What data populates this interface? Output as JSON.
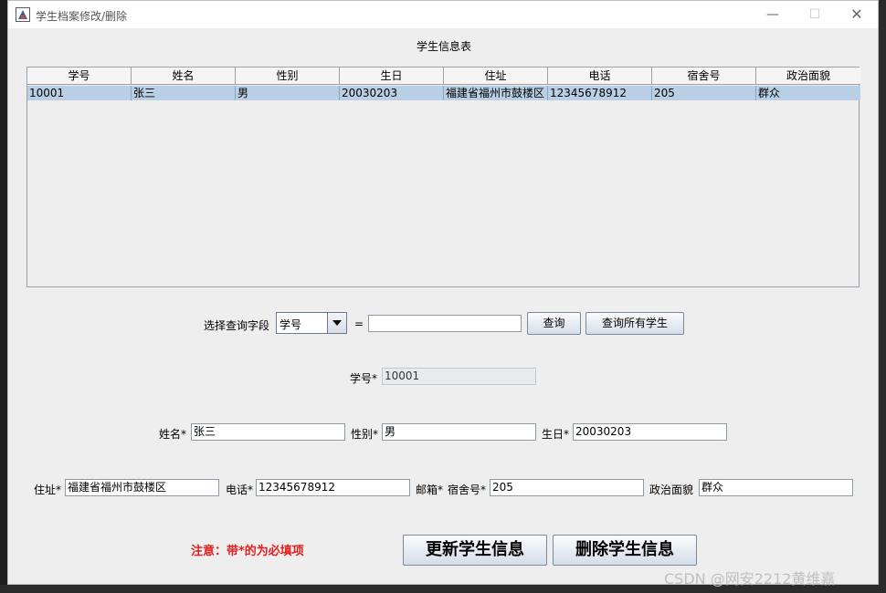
{
  "window": {
    "title": "学生档案修改/删除",
    "controls": {
      "minimize": "—",
      "maximize": "☐",
      "close": "✕"
    }
  },
  "page_title": "学生信息表",
  "table": {
    "columns": [
      "学号",
      "姓名",
      "性别",
      "生日",
      "住址",
      "电话",
      "宿舍号",
      "政治面貌"
    ],
    "rows": [
      [
        "10001",
        "张三",
        "男",
        "20030203",
        "福建省福州市鼓楼区",
        "12345678912",
        "205",
        "群众"
      ]
    ]
  },
  "query": {
    "label": "选择查询字段",
    "field_selected": "学号",
    "equals": "=",
    "value": "",
    "search_button": "查询",
    "all_button": "查询所有学生"
  },
  "form": {
    "id_label": "学号*",
    "id_value": "10001",
    "name_label": "姓名*",
    "name_value": "张三",
    "gender_label": "性别*",
    "gender_value": "男",
    "birthday_label": "生日*",
    "birthday_value": "20030203",
    "address_label": "住址*",
    "address_value": "福建省福州市鼓楼区",
    "phone_label": "电话*",
    "phone_value": "12345678912",
    "email_label": "邮箱*",
    "dorm_label": "宿舍号*",
    "dorm_value": "205",
    "politics_label": "政治面貌",
    "politics_value": "群众"
  },
  "notice": "注意：带*的为必填项",
  "actions": {
    "update": "更新学生信息",
    "delete": "删除学生信息"
  },
  "watermark": "CSDN @网安2212黄维嘉",
  "colors": {
    "selected_row": "#b8cfe5",
    "notice": "#e02020",
    "window_bg": "#eeeeee"
  }
}
